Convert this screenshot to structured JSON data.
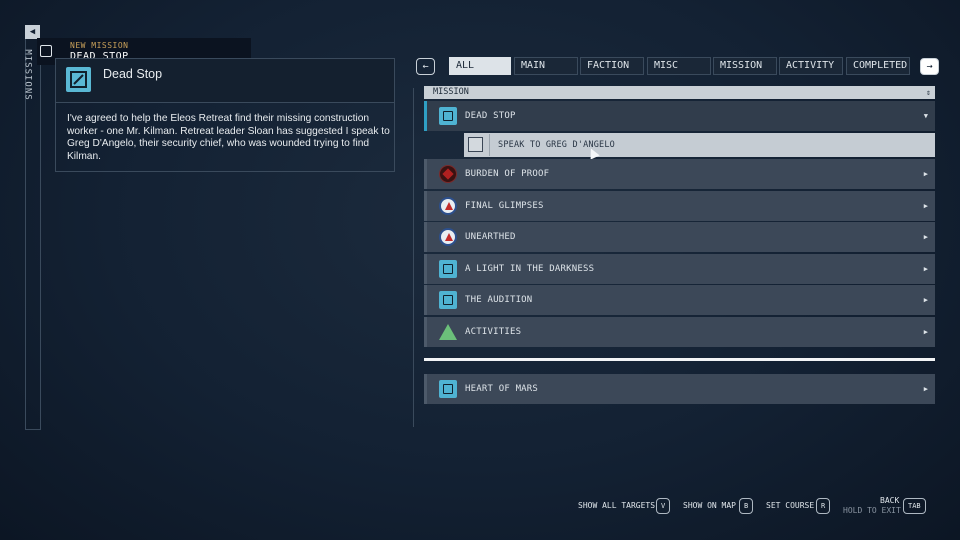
{
  "rail": {
    "label": "MISSIONS",
    "toggle_glyph": "◀"
  },
  "notification": {
    "kicker": "NEW MISSION",
    "title": "DEAD STOP",
    "icon": "mission-icon"
  },
  "detail": {
    "title": "Dead Stop",
    "body": "I've agreed to help the Eleos Retreat find their missing construction worker - one Mr. Kilman. Retreat leader Sloan has suggested I speak to Greg D'Angelo, their security chief, who was wounded trying to find Kilman."
  },
  "tabs": {
    "prev_glyph": "←",
    "next_glyph": "→",
    "items": [
      {
        "label": "ALL",
        "active": true
      },
      {
        "label": "MAIN",
        "active": false
      },
      {
        "label": "FACTION",
        "active": false
      },
      {
        "label": "MISC",
        "active": false
      },
      {
        "label": "MISSION",
        "active": false
      },
      {
        "label": "ACTIVITY",
        "active": false
      },
      {
        "label": "COMPLETED",
        "active": false
      }
    ]
  },
  "list": {
    "header": "MISSION",
    "sort_glyph": "⇕",
    "rows": [
      {
        "label": "DEAD STOP",
        "icon": "mission-icon",
        "chevron": "▼",
        "selected": true
      },
      {
        "label": "BURDEN OF PROOF",
        "icon": "crimson-fleet-icon",
        "chevron": "▶"
      },
      {
        "label": "FINAL GLIMPSES",
        "icon": "united-colonies-icon",
        "chevron": "▶"
      },
      {
        "label": "UNEARTHED",
        "icon": "united-colonies-icon",
        "chevron": "▶"
      },
      {
        "label": "A LIGHT IN THE DARKNESS",
        "icon": "mission-icon",
        "chevron": "▶"
      },
      {
        "label": "THE AUDITION",
        "icon": "mission-icon",
        "chevron": "▶"
      },
      {
        "label": "ACTIVITIES",
        "icon": "activities-icon",
        "chevron": "▶"
      }
    ],
    "objective": {
      "label": "SPEAK TO GREG D'ANGELO"
    },
    "extra_row": {
      "label": "HEART OF MARS",
      "icon": "mission-icon",
      "chevron": "▶"
    }
  },
  "footer": {
    "show_all_targets": {
      "label": "SHOW ALL TARGETS",
      "key": "V"
    },
    "show_on_map": {
      "label": "SHOW ON MAP",
      "key": "B"
    },
    "set_course": {
      "label": "SET COURSE",
      "key": "R"
    },
    "back": {
      "label": "BACK",
      "sublabel": "HOLD TO EXIT",
      "key": "TAB"
    }
  },
  "colors": {
    "accent": "#2f9fc4",
    "background": "#132133",
    "row": "#3c4858"
  }
}
